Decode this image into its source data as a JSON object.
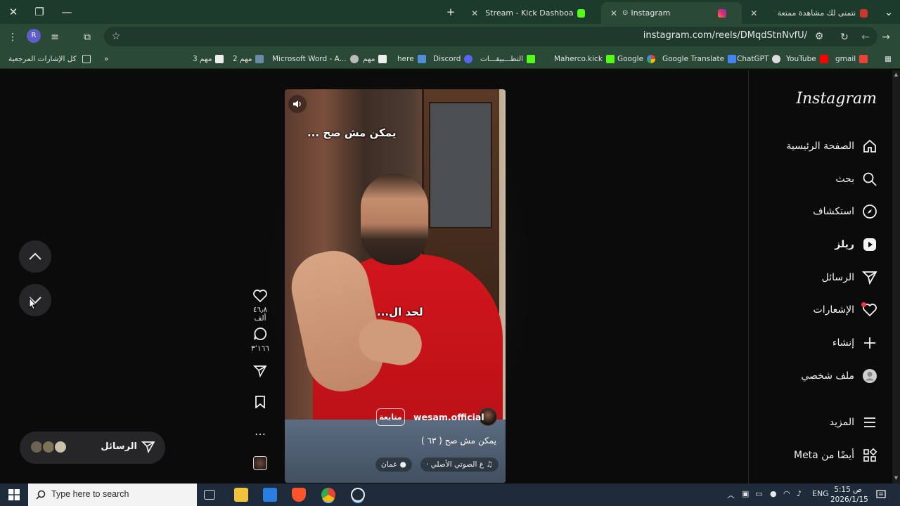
{
  "browser": {
    "window_controls": {
      "close": "✕",
      "maximize": "❐",
      "minimize": "—"
    },
    "new_tab": "+",
    "tabs": [
      {
        "title": "Stream - Kick Dashboard",
        "favicon_color": "#53fc18"
      },
      {
        "title": "Instagram",
        "favicon_color": "#e1306c",
        "active": true
      },
      {
        "title": "نتمنى لك مشاهدة ممتعة ❤️",
        "favicon_color": "#d0342c"
      }
    ],
    "tab_close": "✕",
    "tab_menu": "⌄",
    "profile_initial": "R",
    "url": "instagram.com/reels/DMqdStnNvfU/",
    "bookmarks": {
      "all_bookmarks": "كل الإشارات المرجعية",
      "overflow": "»",
      "items": [
        "مهم 3",
        "مهم 2",
        "Microsoft Word - A...",
        "مهم",
        "here",
        "Discord",
        "التطـــبيقـــات",
        "Maherco.kick",
        "Google",
        "Google Translate",
        "ChatGPT",
        "YouTube",
        "gmail"
      ]
    }
  },
  "reel": {
    "caption_top": "يمكن مش صح ...",
    "caption_mid": "لحد ال...",
    "username": "wesam.official",
    "follow_label": "متابعة",
    "description": "يمكن مش صح ( ٦٣ )",
    "audio": "ع الصوتي الأصلي ·",
    "location": "عمان",
    "likes": "٤٦٫٨ ألف",
    "comments": "٣٬١٦٦",
    "more": "…"
  },
  "messages_pill": {
    "label": "الرسائل"
  },
  "sidebar": {
    "logo": "Instagram",
    "items": [
      {
        "label": "الصفحة الرئيسية",
        "icon": "home-icon"
      },
      {
        "label": "بحث",
        "icon": "search-icon"
      },
      {
        "label": "استكشاف",
        "icon": "compass-icon"
      },
      {
        "label": "ريلز",
        "icon": "reels-icon"
      },
      {
        "label": "الرسائل",
        "icon": "send-icon"
      },
      {
        "label": "الإشعارات",
        "icon": "heart-icon"
      },
      {
        "label": "إنشاء",
        "icon": "plus-icon"
      },
      {
        "label": "ملف شخصي",
        "icon": "profile-icon"
      },
      {
        "label": "المزيد",
        "icon": "menu-icon"
      },
      {
        "label": "أيضًا من Meta",
        "icon": "meta-apps-icon"
      }
    ]
  },
  "taskbar": {
    "search_placeholder": "Type here to search",
    "language": "ENG",
    "time": "5:15 ص",
    "date": "2026/1/15"
  },
  "colors": {
    "tab_strip": "#1c3b2a",
    "toolbar": "#2a4a37",
    "page_bg": "#0b0b0c",
    "notification_dot": "#ff3040"
  }
}
